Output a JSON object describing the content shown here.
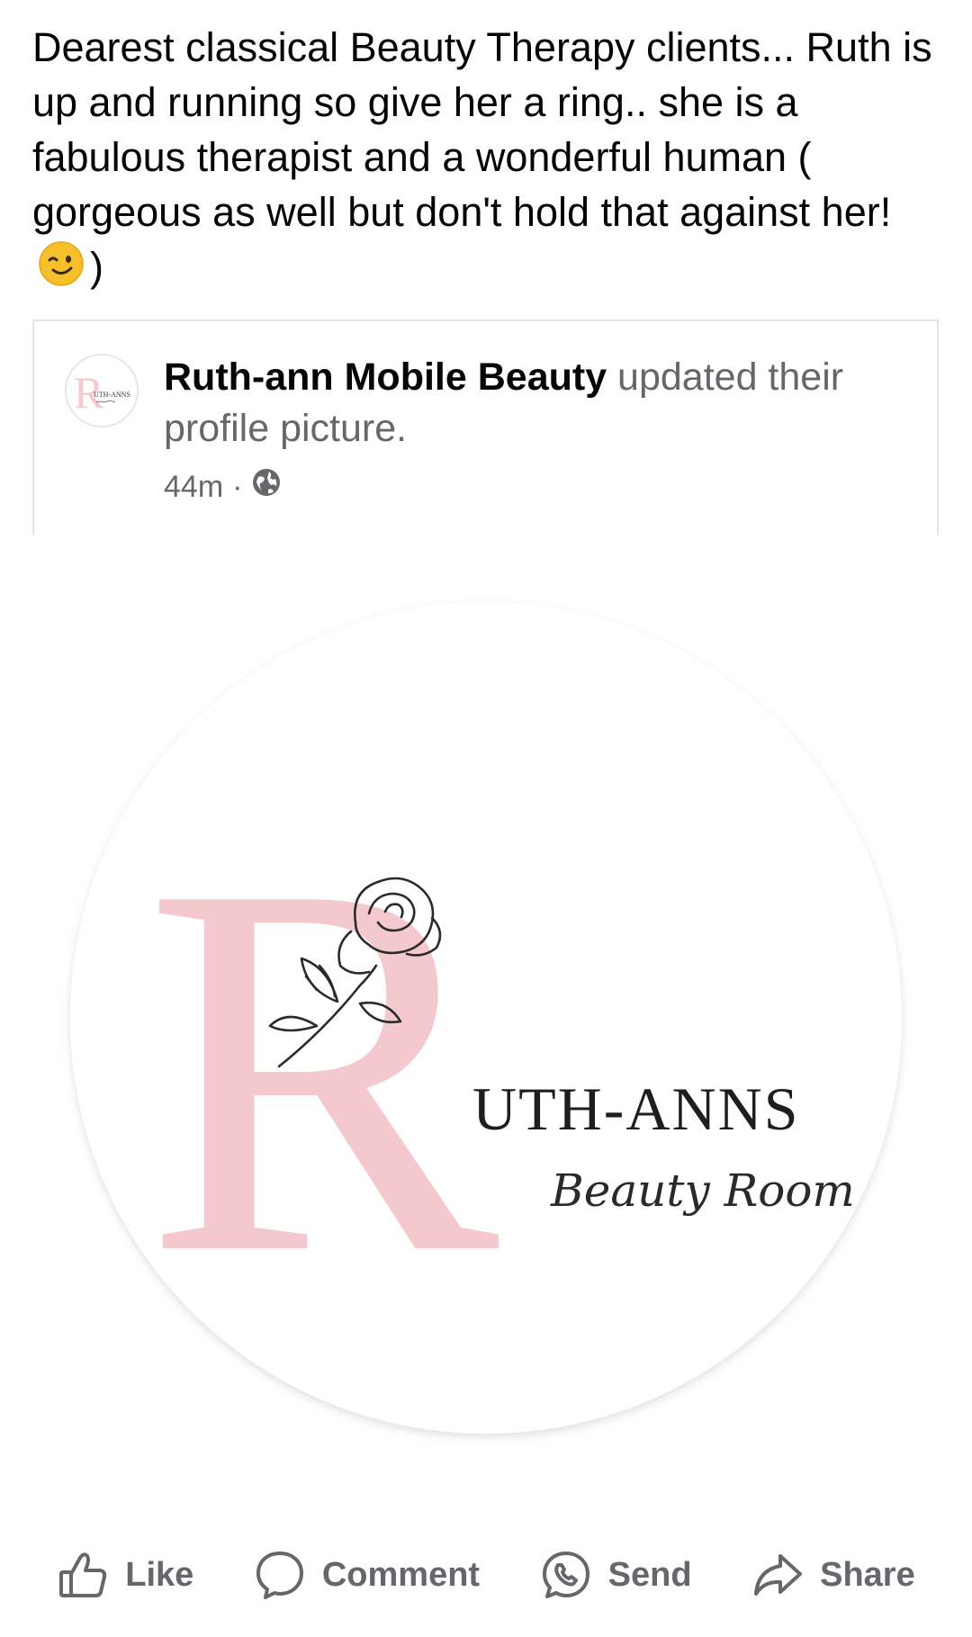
{
  "post": {
    "text_before_emoji": "Dearest classical Beauty Therapy clients... Ruth is up and running so give her a ring.. she is a fabulous therapist and a wonderful human ( gorgeous as well but don't hold that against her!",
    "emoji": "winking-face-emoji",
    "text_after_emoji": ")"
  },
  "shared": {
    "page_name": "Ruth-ann Mobile Beauty",
    "action_text": " updated their profile picture.",
    "time": "44m",
    "separator": "·",
    "audience_icon": "globe-icon"
  },
  "logo": {
    "brand_text": "UTH-ANNS",
    "script_text": "Beauty Room",
    "letter": "R",
    "letter_color": "#f4c9cd",
    "ink_color": "#2a2a2a",
    "avatar_brand_text": "UTH-ANNS"
  },
  "actions": [
    {
      "label": "Like",
      "icon": "thumbs-up-icon"
    },
    {
      "label": "Comment",
      "icon": "comment-bubble-icon"
    },
    {
      "label": "Send",
      "icon": "messenger-send-icon"
    },
    {
      "label": "Share",
      "icon": "share-arrow-icon"
    }
  ],
  "colors": {
    "text_primary": "#050505",
    "text_secondary": "#65676b",
    "divider": "#e4e6eb"
  }
}
